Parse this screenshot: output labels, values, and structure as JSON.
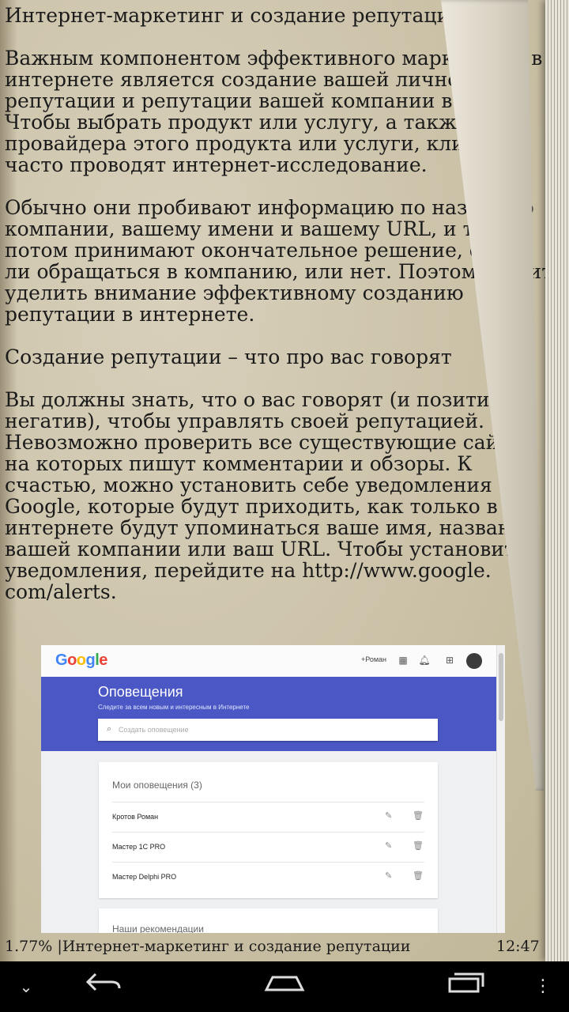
{
  "book": {
    "heading": "Интернет-маркетинг и создание репутации",
    "paragraphs": [
      "Важным компонентом эффективного маркетинга в интернете является создание вашей личной репутации и репутации вашей компании в сети. Чтобы выбрать продукт или услугу, а также провайдера этого продукта или услуги, клиенты часто проводят интернет-исследование.",
      "Обычно они пробивают информацию по названию компании, вашему имени и вашему URL, и только потом принимают окончательное решение, стоит ли обращаться в компанию, или нет. Поэтому стоит уделить внимание эффективному созданию репутации в интернете."
    ],
    "subheading": "Создание репутации – что про вас говорят",
    "paragraph3": "Вы должны знать, что о вас говорят (и позитив, и негатив), чтобы управлять своей репутацией. Невозможно проверить все существующие сайты, на которых пишут комментарии и обзоры. К счастью, можно установить себе уведомления от Google, которые будут приходить, как только в интернете будут упоминаться ваше имя, название вашей компании или ваш URL. Чтобы установить уведомления, перейдите на http://www.google. com/alerts."
  },
  "screenshot": {
    "logo_letters": [
      "G",
      "o",
      "o",
      "g",
      "l",
      "e"
    ],
    "logo_colors": [
      "#4285F4",
      "#EA4335",
      "#FBBC05",
      "#4285F4",
      "#34A853",
      "#EA4335"
    ],
    "user": "+Роман",
    "header_title": "Оповещения",
    "header_subtitle": "Следите за всем новым и интересным в Интернете",
    "search_placeholder": "Создать оповещение",
    "alerts_title": "Мои оповещения (3)",
    "alerts": [
      "Кротов Роман",
      "Мастер 1С PRO",
      "Мастер Delphi PRO"
    ],
    "second_card_title": "Наши рекомендации"
  },
  "status": {
    "progress": "1.77%",
    "separator": "|",
    "title": "Интернет-маркетинг и создание репутации",
    "time": "12:47"
  },
  "icons": {
    "apps": "apps-icon",
    "bell": "bell-icon",
    "plus": "plus-box-icon",
    "edit": "pencil-icon",
    "delete": "trash-icon",
    "back": "back-icon",
    "home": "home-icon",
    "recents": "recents-icon",
    "menu": "menu-icon",
    "hide_keyboard": "chevron-down-icon"
  }
}
